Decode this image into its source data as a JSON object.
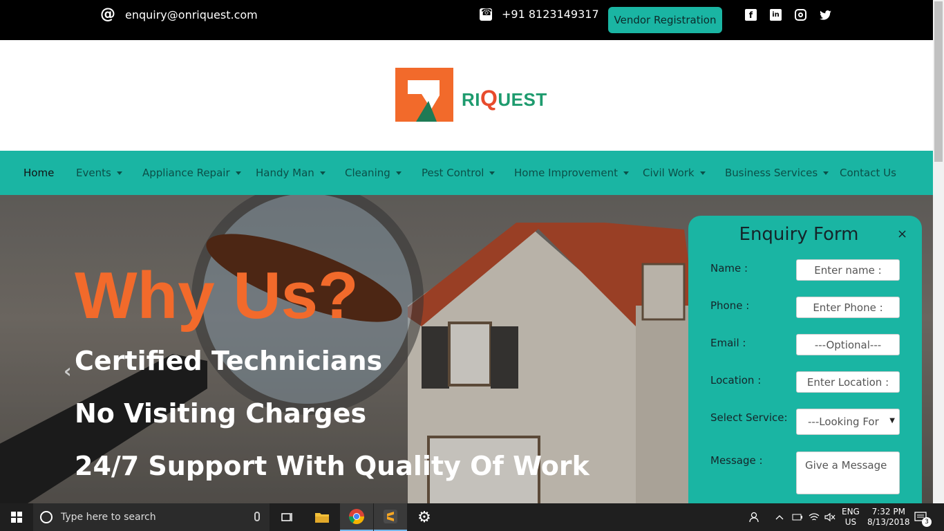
{
  "topbar": {
    "email": "enquiry@onriquest.com",
    "phone": "+91 8123149317",
    "vendor_label": "Vendor Registration",
    "social": [
      "facebook-icon",
      "linkedin-icon",
      "instagram-icon",
      "twitter-icon"
    ]
  },
  "logo": {
    "text_ri": "RI",
    "text_q": "Q",
    "text_uest": "UEST"
  },
  "nav": {
    "items": [
      {
        "label": "Home",
        "dropdown": false
      },
      {
        "label": "Events",
        "dropdown": true
      },
      {
        "label": "Appliance Repair",
        "dropdown": true
      },
      {
        "label": "Handy Man",
        "dropdown": true
      },
      {
        "label": "Cleaning",
        "dropdown": true
      },
      {
        "label": "Pest Control",
        "dropdown": true
      },
      {
        "label": "Home Improvement",
        "dropdown": true
      },
      {
        "label": "Civil Work",
        "dropdown": true
      },
      {
        "label": "Business Services",
        "dropdown": true
      },
      {
        "label": "Contact Us",
        "dropdown": false
      }
    ]
  },
  "hero": {
    "heading": "Why Us?",
    "lines": [
      "Certified Technicians",
      "No Visiting Charges",
      "24/7 Support With Quality Of Work"
    ]
  },
  "enquiry": {
    "title": "Enquiry Form",
    "close": "×",
    "fields": [
      {
        "label": "Name :",
        "placeholder": "Enter name :"
      },
      {
        "label": "Phone :",
        "placeholder": "Enter Phone :"
      },
      {
        "label": "Email :",
        "placeholder": "---Optional---"
      },
      {
        "label": "Location :",
        "placeholder": "Enter Location :"
      }
    ],
    "service_label": "Select Service:",
    "service_value": "---Looking For",
    "message_label": "Message :",
    "message_placeholder": "Give a Message"
  },
  "taskbar": {
    "search_placeholder": "Type here to search",
    "lang_1": "ENG",
    "lang_2": "US",
    "time": "7:32 PM",
    "date": "8/13/2018",
    "notifications": "3"
  },
  "colors": {
    "accent": "#1ab5a3",
    "orange": "#f26a2b",
    "topbar": "#000000"
  }
}
